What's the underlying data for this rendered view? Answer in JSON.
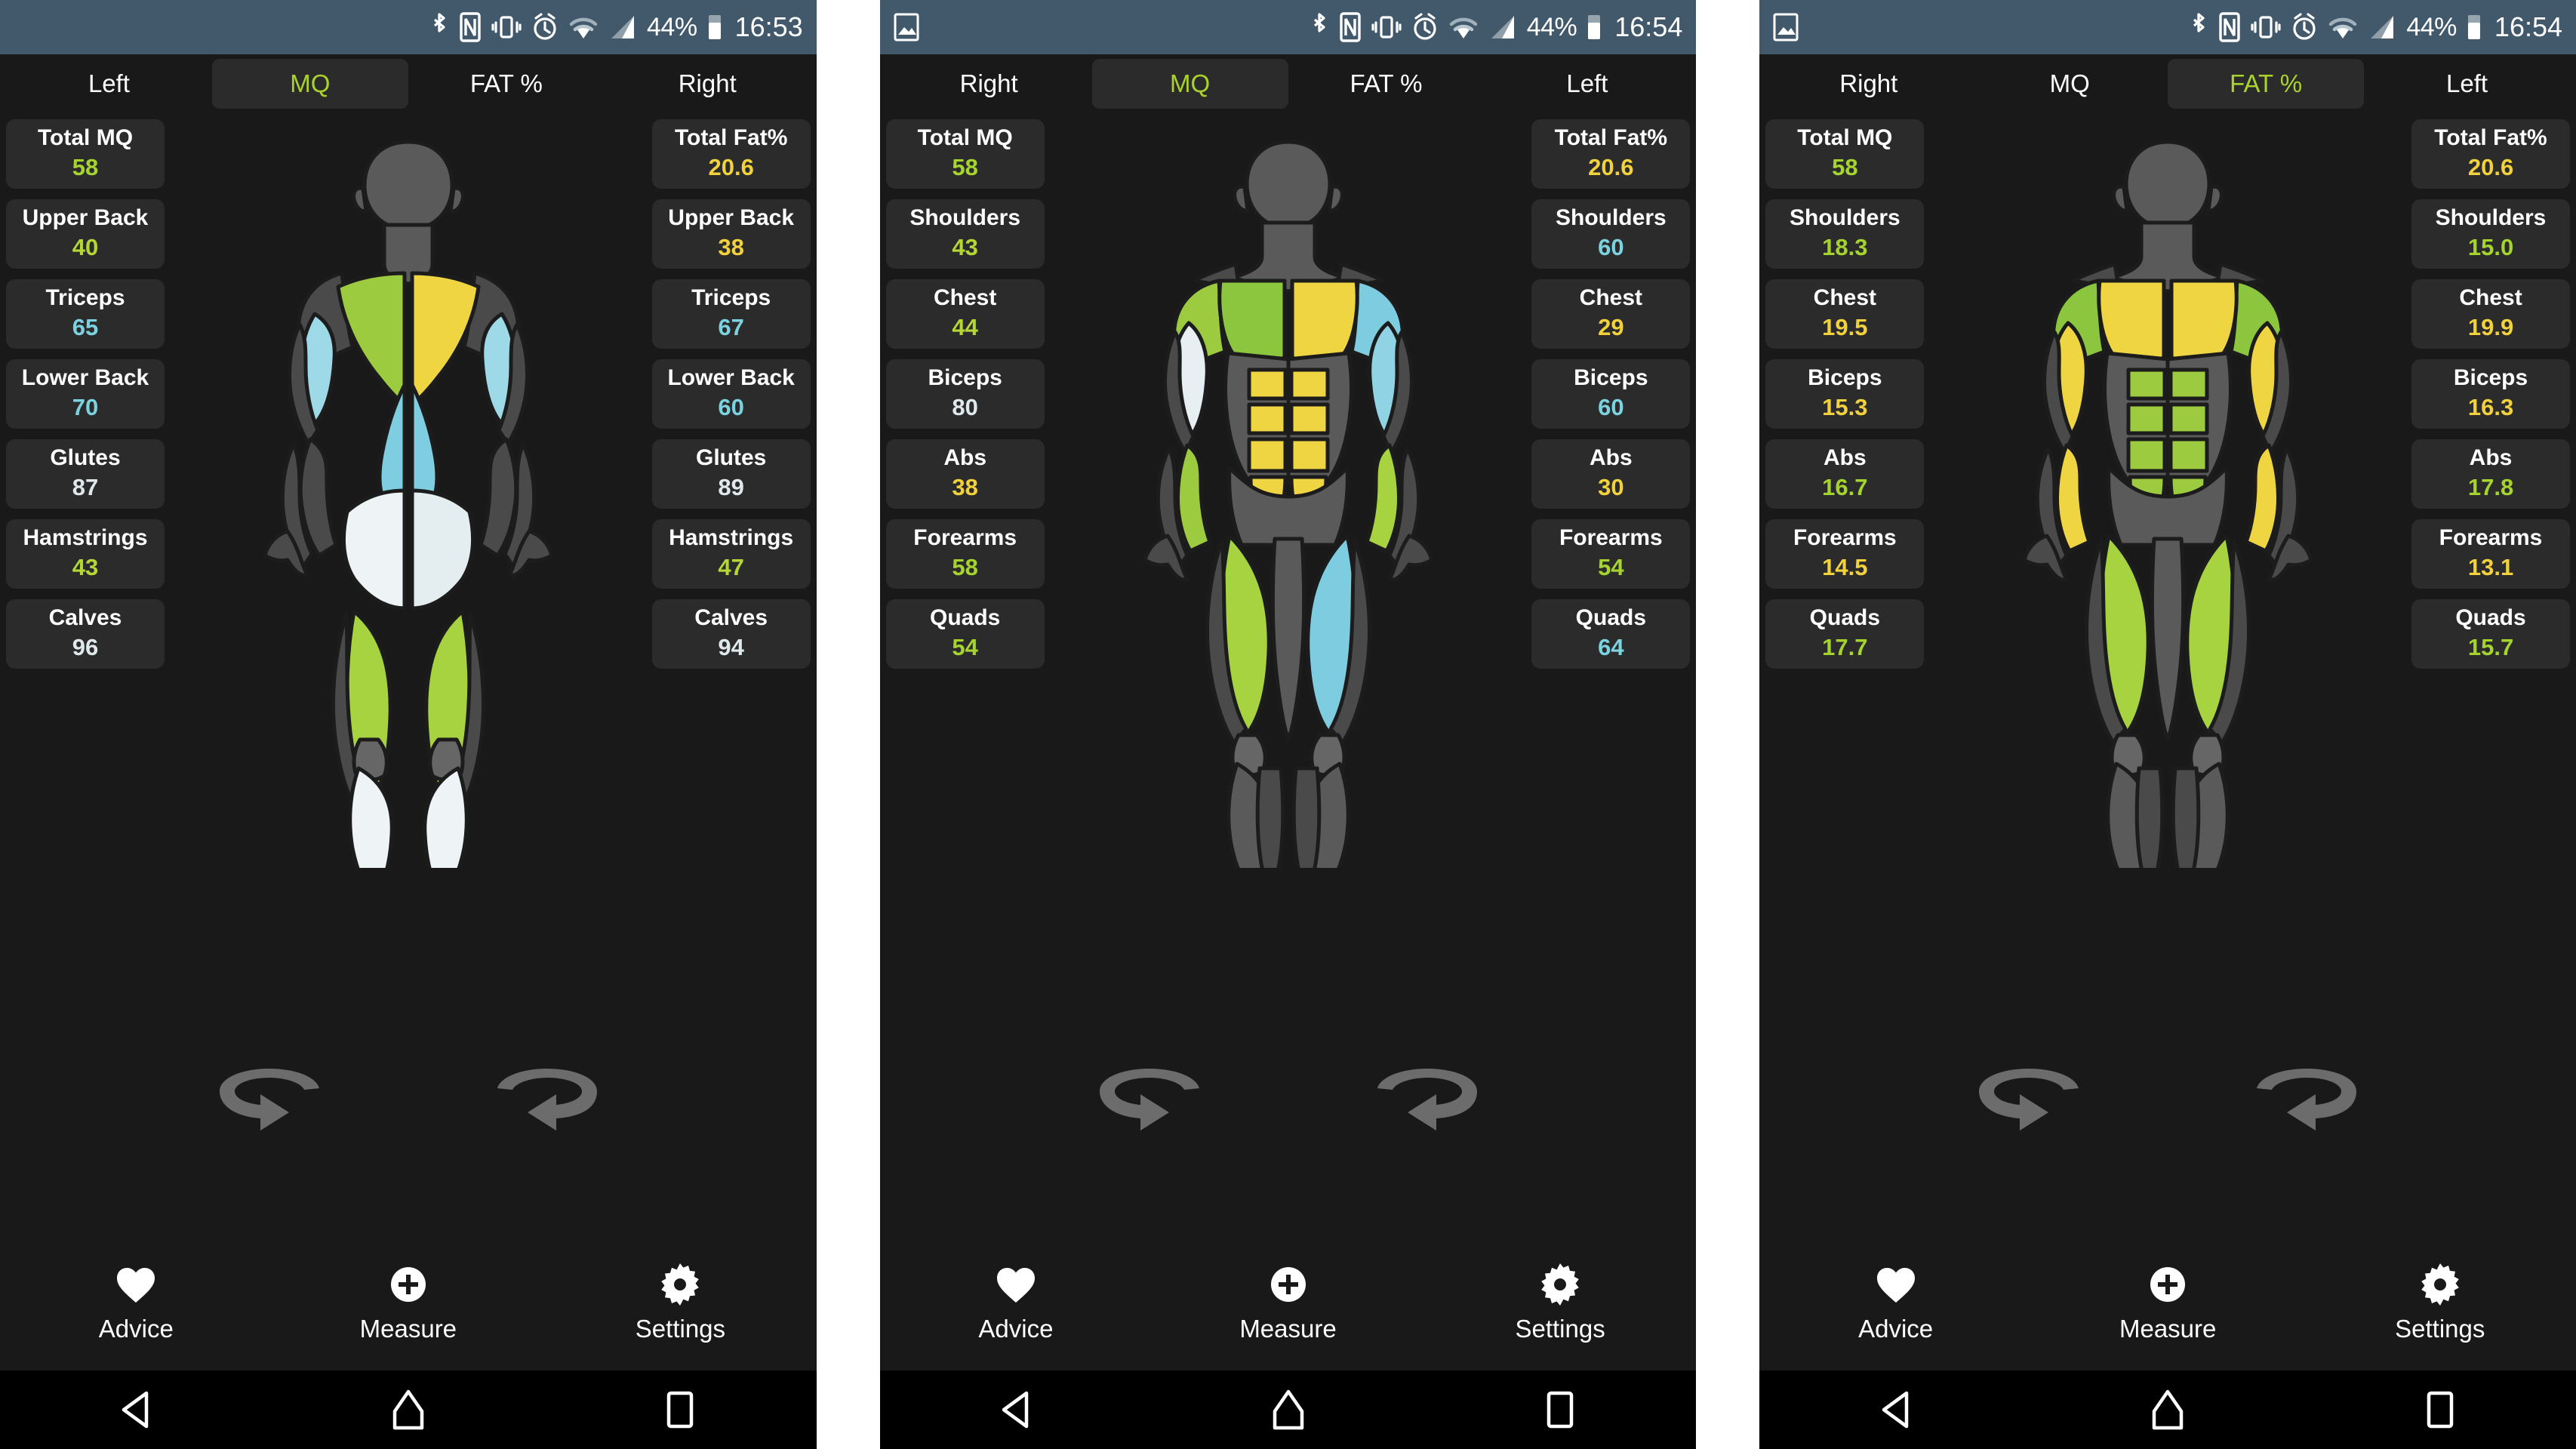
{
  "app": {
    "colors": {
      "bg": "#191919",
      "card": "#2b2b2b",
      "statusbar": "#41596b",
      "accent_green": "#aad22a",
      "value_green": "#a6d42e",
      "value_yellow": "#f2d23c",
      "value_blue": "#7dd2e0",
      "value_white": "#dfe9ec",
      "muscle_grey": "#5a5a5a"
    }
  },
  "panels": [
    {
      "id": "panel-1",
      "statusbar": {
        "gallery_icon": false,
        "icons": [
          "bluetooth-icon",
          "nfc-icon",
          "vibrate-icon",
          "alarm-icon",
          "wifi-icon",
          "signal-icon"
        ],
        "battery": "44%",
        "clock": "16:53"
      },
      "tabs": {
        "left_label": "Left",
        "right_label": "Right",
        "items": [
          {
            "label": "MQ",
            "selected": true
          },
          {
            "label": "FAT %",
            "selected": false
          }
        ]
      },
      "view": "back",
      "left_column": [
        {
          "label": "Total MQ",
          "value": "58",
          "color": "#a6d42e"
        },
        {
          "label": "Upper Back",
          "value": "40",
          "color": "#b5d736"
        },
        {
          "label": "Triceps",
          "value": "65",
          "color": "#7dd2e0"
        },
        {
          "label": "Lower Back",
          "value": "70",
          "color": "#7dd2e0"
        },
        {
          "label": "Glutes",
          "value": "87",
          "color": "#dfe9ec"
        },
        {
          "label": "Hamstrings",
          "value": "43",
          "color": "#b5d736"
        },
        {
          "label": "Calves",
          "value": "96",
          "color": "#dfe9ec"
        }
      ],
      "right_column": [
        {
          "label": "Total Fat%",
          "value": "20.6",
          "color": "#f2d23c"
        },
        {
          "label": "Upper Back",
          "value": "38",
          "color": "#f2d23c"
        },
        {
          "label": "Triceps",
          "value": "67",
          "color": "#7dd2e0"
        },
        {
          "label": "Lower Back",
          "value": "60",
          "color": "#7dd2e0"
        },
        {
          "label": "Glutes",
          "value": "89",
          "color": "#dfe9ec"
        },
        {
          "label": "Hamstrings",
          "value": "47",
          "color": "#b5d736"
        },
        {
          "label": "Calves",
          "value": "94",
          "color": "#dfe9ec"
        }
      ],
      "bottom_nav": [
        {
          "label": "Advice",
          "icon": "heart-icon"
        },
        {
          "label": "Measure",
          "icon": "plus-circle-icon"
        },
        {
          "label": "Settings",
          "icon": "gear-icon"
        }
      ],
      "android_nav": [
        "back-triangle-icon",
        "home-icon",
        "recents-square-icon"
      ]
    },
    {
      "id": "panel-2",
      "statusbar": {
        "gallery_icon": true,
        "icons": [
          "bluetooth-icon",
          "nfc-icon",
          "vibrate-icon",
          "alarm-icon",
          "wifi-icon",
          "signal-icon"
        ],
        "battery": "44%",
        "clock": "16:54"
      },
      "tabs": {
        "left_label": "Right",
        "right_label": "Left",
        "items": [
          {
            "label": "MQ",
            "selected": true
          },
          {
            "label": "FAT %",
            "selected": false
          }
        ]
      },
      "view": "front",
      "left_column": [
        {
          "label": "Total MQ",
          "value": "58",
          "color": "#a6d42e"
        },
        {
          "label": "Shoulders",
          "value": "43",
          "color": "#b5d736"
        },
        {
          "label": "Chest",
          "value": "44",
          "color": "#b5d736"
        },
        {
          "label": "Biceps",
          "value": "80",
          "color": "#dfe9ec"
        },
        {
          "label": "Abs",
          "value": "38",
          "color": "#f2d23c"
        },
        {
          "label": "Forearms",
          "value": "58",
          "color": "#a6d42e"
        },
        {
          "label": "Quads",
          "value": "54",
          "color": "#a6d42e"
        }
      ],
      "right_column": [
        {
          "label": "Total Fat%",
          "value": "20.6",
          "color": "#f2d23c"
        },
        {
          "label": "Shoulders",
          "value": "60",
          "color": "#7dd2e0"
        },
        {
          "label": "Chest",
          "value": "29",
          "color": "#f2d23c"
        },
        {
          "label": "Biceps",
          "value": "60",
          "color": "#7dd2e0"
        },
        {
          "label": "Abs",
          "value": "30",
          "color": "#f2d23c"
        },
        {
          "label": "Forearms",
          "value": "54",
          "color": "#a6d42e"
        },
        {
          "label": "Quads",
          "value": "64",
          "color": "#7dd2e0"
        }
      ],
      "bottom_nav": [
        {
          "label": "Advice",
          "icon": "heart-icon"
        },
        {
          "label": "Measure",
          "icon": "plus-circle-icon"
        },
        {
          "label": "Settings",
          "icon": "gear-icon"
        }
      ],
      "android_nav": [
        "back-triangle-icon",
        "home-icon",
        "recents-square-icon"
      ]
    },
    {
      "id": "panel-3",
      "statusbar": {
        "gallery_icon": true,
        "icons": [
          "bluetooth-icon",
          "nfc-icon",
          "vibrate-icon",
          "alarm-icon",
          "wifi-icon",
          "signal-icon"
        ],
        "battery": "44%",
        "clock": "16:54"
      },
      "tabs": {
        "left_label": "Right",
        "right_label": "Left",
        "items": [
          {
            "label": "MQ",
            "selected": false
          },
          {
            "label": "FAT %",
            "selected": true
          }
        ]
      },
      "view": "front-fat",
      "left_column": [
        {
          "label": "Total MQ",
          "value": "58",
          "color": "#a6d42e"
        },
        {
          "label": "Shoulders",
          "value": "18.3",
          "color": "#a6d42e"
        },
        {
          "label": "Chest",
          "value": "19.5",
          "color": "#f2d23c"
        },
        {
          "label": "Biceps",
          "value": "15.3",
          "color": "#f2d23c"
        },
        {
          "label": "Abs",
          "value": "16.7",
          "color": "#a6d42e"
        },
        {
          "label": "Forearms",
          "value": "14.5",
          "color": "#f2d23c"
        },
        {
          "label": "Quads",
          "value": "17.7",
          "color": "#a6d42e"
        }
      ],
      "right_column": [
        {
          "label": "Total Fat%",
          "value": "20.6",
          "color": "#f2d23c"
        },
        {
          "label": "Shoulders",
          "value": "15.0",
          "color": "#a6d42e"
        },
        {
          "label": "Chest",
          "value": "19.9",
          "color": "#f2d23c"
        },
        {
          "label": "Biceps",
          "value": "16.3",
          "color": "#f2d23c"
        },
        {
          "label": "Abs",
          "value": "17.8",
          "color": "#a6d42e"
        },
        {
          "label": "Forearms",
          "value": "13.1",
          "color": "#f2d23c"
        },
        {
          "label": "Quads",
          "value": "15.7",
          "color": "#a6d42e"
        }
      ],
      "bottom_nav": [
        {
          "label": "Advice",
          "icon": "heart-icon"
        },
        {
          "label": "Measure",
          "icon": "plus-circle-icon"
        },
        {
          "label": "Settings",
          "icon": "gear-icon"
        }
      ],
      "android_nav": [
        "back-triangle-icon",
        "home-icon",
        "recents-square-icon"
      ]
    }
  ]
}
